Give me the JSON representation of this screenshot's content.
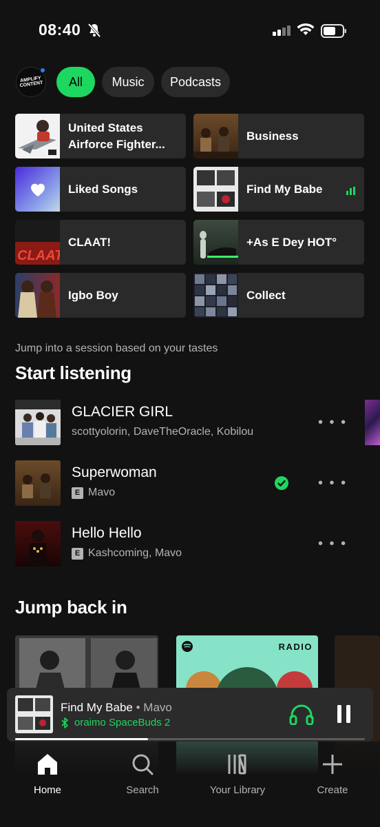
{
  "status_bar": {
    "time": "08:40"
  },
  "filters": {
    "profile_logo": "AMPLIFY CONTENT",
    "chips": [
      "All",
      "Music",
      "Podcasts"
    ]
  },
  "shortcuts": [
    {
      "label": "United States Airforce Fighter..."
    },
    {
      "label": "Business"
    },
    {
      "label": "Liked Songs"
    },
    {
      "label": "Find My Babe",
      "playing": true
    },
    {
      "label": "CLAAT!"
    },
    {
      "label": "+As E Dey HOT°"
    },
    {
      "label": "Igbo Boy"
    },
    {
      "label": "Collect"
    }
  ],
  "start_listening": {
    "subheading": "Jump into a session based on your tastes",
    "heading": "Start listening",
    "tracks": [
      {
        "title": "GLACIER GIRL",
        "artists": "scottyolorin, DaveTheOracle, Kobilou",
        "explicit": false
      },
      {
        "title": "Superwoman",
        "artists": "Mavo",
        "explicit": true,
        "explicit_badge": "E",
        "downloaded": true
      },
      {
        "title": "Hello Hello",
        "artists": "Kashcoming, Mavo",
        "explicit": true,
        "explicit_badge": "E"
      }
    ]
  },
  "jump_back_in": {
    "heading": "Jump back in",
    "radio_badge": "RADIO"
  },
  "mini_player": {
    "song": "Find My Babe",
    "separator": " • ",
    "artist": "Mavo",
    "device": "oraimo SpaceBuds 2",
    "progress": 0.38
  },
  "nav": [
    {
      "label": "Home",
      "active": true
    },
    {
      "label": "Search"
    },
    {
      "label": "Your Library"
    },
    {
      "label": "Create"
    }
  ],
  "colors": {
    "accent": "#1ed760",
    "background": "#121212",
    "tile": "#2a2a2a"
  }
}
